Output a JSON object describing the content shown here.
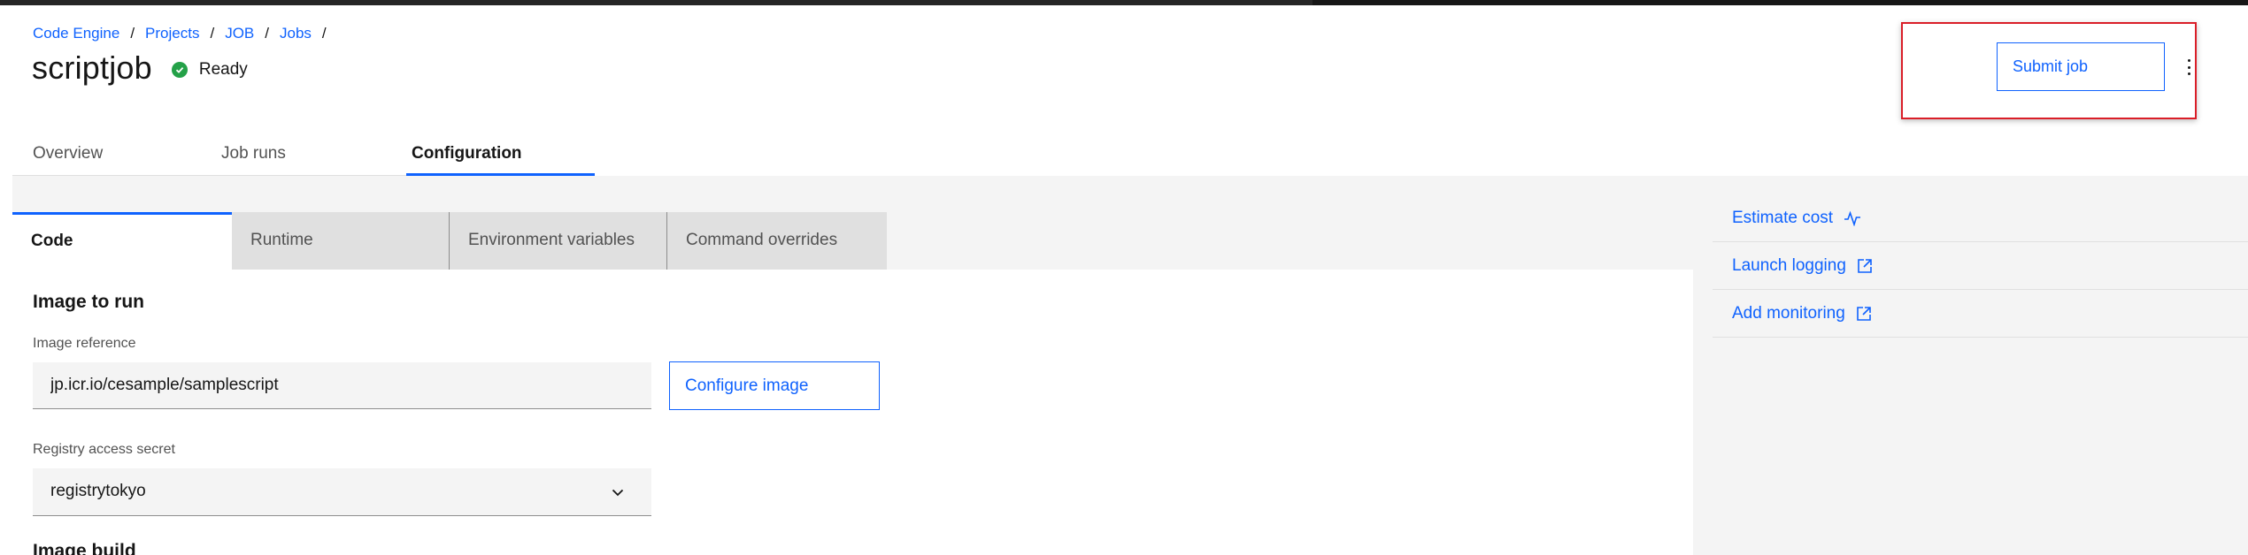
{
  "breadcrumb": {
    "items": [
      "Code Engine",
      "Projects",
      "JOB",
      "Jobs"
    ],
    "separator": "/"
  },
  "header": {
    "title": "scriptjob",
    "status": "Ready",
    "status_color": "#24a148",
    "submit_label": "Submit job",
    "overflow_icon": "overflow-menu-vertical-icon"
  },
  "annotation": {
    "color": "#da1e28"
  },
  "tabs": [
    {
      "label": "Overview",
      "selected": false
    },
    {
      "label": "Job runs",
      "selected": false
    },
    {
      "label": "Configuration",
      "selected": true
    }
  ],
  "content_tabs": [
    {
      "label": "Code",
      "selected": true
    },
    {
      "label": "Runtime",
      "selected": false
    },
    {
      "label": "Environment variables",
      "selected": false
    },
    {
      "label": "Command overrides",
      "selected": false
    }
  ],
  "image_section": {
    "title": "Image to run",
    "image_reference_label": "Image reference",
    "image_reference_value": "jp.icr.io/cesample/samplescript",
    "configure_label": "Configure image",
    "registry_label": "Registry access secret",
    "registry_value": "registrytokyo",
    "next_section_title": "Image build"
  },
  "side_links": [
    {
      "label": "Estimate cost",
      "icon": "activity-icon"
    },
    {
      "label": "Launch logging",
      "icon": "launch-icon"
    },
    {
      "label": "Add monitoring",
      "icon": "launch-icon"
    }
  ],
  "colors": {
    "accent": "#0f62fe",
    "text": "#161616",
    "secondary_text": "#525252",
    "layer": "#f4f4f4"
  }
}
